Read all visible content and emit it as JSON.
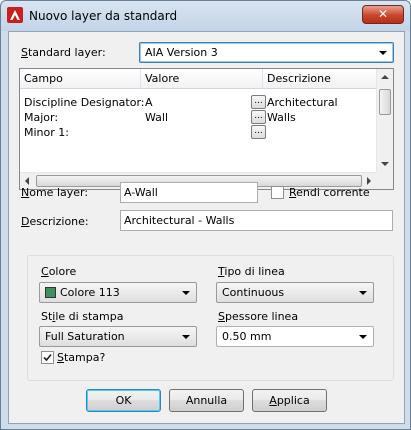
{
  "window": {
    "title": "Nuovo layer da standard",
    "close_label": "✕"
  },
  "standard_layer": {
    "label_u": "S",
    "label_rest": "tandard layer:",
    "value": "AIA Version 3"
  },
  "table": {
    "columns": [
      "Campo",
      "Valore",
      "Descrizione"
    ],
    "rows": [
      {
        "campo": "Discipline Designator:",
        "valore": "A",
        "button": "...",
        "descrizione": "Architectural"
      },
      {
        "campo": "Major:",
        "valore": "Wall",
        "button": "...",
        "descrizione": "Walls"
      },
      {
        "campo": "Minor 1:",
        "valore": "",
        "button": "...",
        "descrizione": ""
      }
    ]
  },
  "layer_name": {
    "label_u": "N",
    "label_rest": "ome layer:",
    "value": "A-Wall"
  },
  "make_current": {
    "label_u": "R",
    "label_rest": "endi corrente",
    "checked": false
  },
  "description": {
    "label_u": "D",
    "label_rest": "escrizione:",
    "value": "Architectural - Walls"
  },
  "properties": {
    "color": {
      "label_u": "C",
      "label_rest": "olore",
      "value": "Colore 113",
      "swatch_color": "#3f8f5f"
    },
    "linetype": {
      "label_u": "T",
      "label_rest": "ipo di linea",
      "value": "Continuous"
    },
    "plot_style": {
      "label_pre": "St",
      "label_u": "i",
      "label_rest": "le di stampa",
      "value": "Full Saturation"
    },
    "lineweight": {
      "label_u": "S",
      "label_rest": "pessore linea",
      "value": "0.50 mm"
    },
    "plot": {
      "label_u": "S",
      "label_rest": "tampa?",
      "checked": true
    }
  },
  "buttons": {
    "ok": "OK",
    "cancel": "Annulla",
    "apply_u": "A",
    "apply_rest": "pplica"
  }
}
